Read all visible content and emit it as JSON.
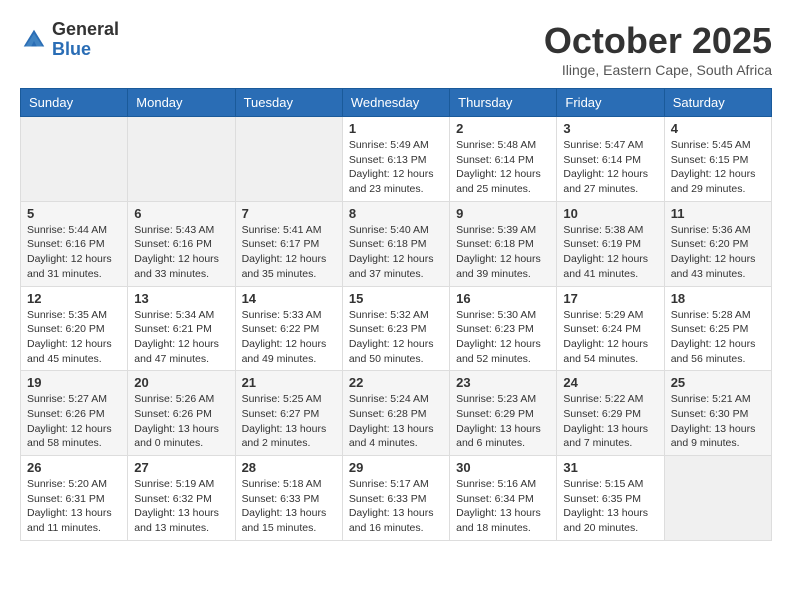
{
  "logo": {
    "general": "General",
    "blue": "Blue"
  },
  "header": {
    "month": "October 2025",
    "location": "Ilinge, Eastern Cape, South Africa"
  },
  "weekdays": [
    "Sunday",
    "Monday",
    "Tuesday",
    "Wednesday",
    "Thursday",
    "Friday",
    "Saturday"
  ],
  "weeks": [
    [
      {
        "day": "",
        "info": ""
      },
      {
        "day": "",
        "info": ""
      },
      {
        "day": "",
        "info": ""
      },
      {
        "day": "1",
        "info": "Sunrise: 5:49 AM\nSunset: 6:13 PM\nDaylight: 12 hours\nand 23 minutes."
      },
      {
        "day": "2",
        "info": "Sunrise: 5:48 AM\nSunset: 6:14 PM\nDaylight: 12 hours\nand 25 minutes."
      },
      {
        "day": "3",
        "info": "Sunrise: 5:47 AM\nSunset: 6:14 PM\nDaylight: 12 hours\nand 27 minutes."
      },
      {
        "day": "4",
        "info": "Sunrise: 5:45 AM\nSunset: 6:15 PM\nDaylight: 12 hours\nand 29 minutes."
      }
    ],
    [
      {
        "day": "5",
        "info": "Sunrise: 5:44 AM\nSunset: 6:16 PM\nDaylight: 12 hours\nand 31 minutes."
      },
      {
        "day": "6",
        "info": "Sunrise: 5:43 AM\nSunset: 6:16 PM\nDaylight: 12 hours\nand 33 minutes."
      },
      {
        "day": "7",
        "info": "Sunrise: 5:41 AM\nSunset: 6:17 PM\nDaylight: 12 hours\nand 35 minutes."
      },
      {
        "day": "8",
        "info": "Sunrise: 5:40 AM\nSunset: 6:18 PM\nDaylight: 12 hours\nand 37 minutes."
      },
      {
        "day": "9",
        "info": "Sunrise: 5:39 AM\nSunset: 6:18 PM\nDaylight: 12 hours\nand 39 minutes."
      },
      {
        "day": "10",
        "info": "Sunrise: 5:38 AM\nSunset: 6:19 PM\nDaylight: 12 hours\nand 41 minutes."
      },
      {
        "day": "11",
        "info": "Sunrise: 5:36 AM\nSunset: 6:20 PM\nDaylight: 12 hours\nand 43 minutes."
      }
    ],
    [
      {
        "day": "12",
        "info": "Sunrise: 5:35 AM\nSunset: 6:20 PM\nDaylight: 12 hours\nand 45 minutes."
      },
      {
        "day": "13",
        "info": "Sunrise: 5:34 AM\nSunset: 6:21 PM\nDaylight: 12 hours\nand 47 minutes."
      },
      {
        "day": "14",
        "info": "Sunrise: 5:33 AM\nSunset: 6:22 PM\nDaylight: 12 hours\nand 49 minutes."
      },
      {
        "day": "15",
        "info": "Sunrise: 5:32 AM\nSunset: 6:23 PM\nDaylight: 12 hours\nand 50 minutes."
      },
      {
        "day": "16",
        "info": "Sunrise: 5:30 AM\nSunset: 6:23 PM\nDaylight: 12 hours\nand 52 minutes."
      },
      {
        "day": "17",
        "info": "Sunrise: 5:29 AM\nSunset: 6:24 PM\nDaylight: 12 hours\nand 54 minutes."
      },
      {
        "day": "18",
        "info": "Sunrise: 5:28 AM\nSunset: 6:25 PM\nDaylight: 12 hours\nand 56 minutes."
      }
    ],
    [
      {
        "day": "19",
        "info": "Sunrise: 5:27 AM\nSunset: 6:26 PM\nDaylight: 12 hours\nand 58 minutes."
      },
      {
        "day": "20",
        "info": "Sunrise: 5:26 AM\nSunset: 6:26 PM\nDaylight: 13 hours\nand 0 minutes."
      },
      {
        "day": "21",
        "info": "Sunrise: 5:25 AM\nSunset: 6:27 PM\nDaylight: 13 hours\nand 2 minutes."
      },
      {
        "day": "22",
        "info": "Sunrise: 5:24 AM\nSunset: 6:28 PM\nDaylight: 13 hours\nand 4 minutes."
      },
      {
        "day": "23",
        "info": "Sunrise: 5:23 AM\nSunset: 6:29 PM\nDaylight: 13 hours\nand 6 minutes."
      },
      {
        "day": "24",
        "info": "Sunrise: 5:22 AM\nSunset: 6:29 PM\nDaylight: 13 hours\nand 7 minutes."
      },
      {
        "day": "25",
        "info": "Sunrise: 5:21 AM\nSunset: 6:30 PM\nDaylight: 13 hours\nand 9 minutes."
      }
    ],
    [
      {
        "day": "26",
        "info": "Sunrise: 5:20 AM\nSunset: 6:31 PM\nDaylight: 13 hours\nand 11 minutes."
      },
      {
        "day": "27",
        "info": "Sunrise: 5:19 AM\nSunset: 6:32 PM\nDaylight: 13 hours\nand 13 minutes."
      },
      {
        "day": "28",
        "info": "Sunrise: 5:18 AM\nSunset: 6:33 PM\nDaylight: 13 hours\nand 15 minutes."
      },
      {
        "day": "29",
        "info": "Sunrise: 5:17 AM\nSunset: 6:33 PM\nDaylight: 13 hours\nand 16 minutes."
      },
      {
        "day": "30",
        "info": "Sunrise: 5:16 AM\nSunset: 6:34 PM\nDaylight: 13 hours\nand 18 minutes."
      },
      {
        "day": "31",
        "info": "Sunrise: 5:15 AM\nSunset: 6:35 PM\nDaylight: 13 hours\nand 20 minutes."
      },
      {
        "day": "",
        "info": ""
      }
    ]
  ]
}
